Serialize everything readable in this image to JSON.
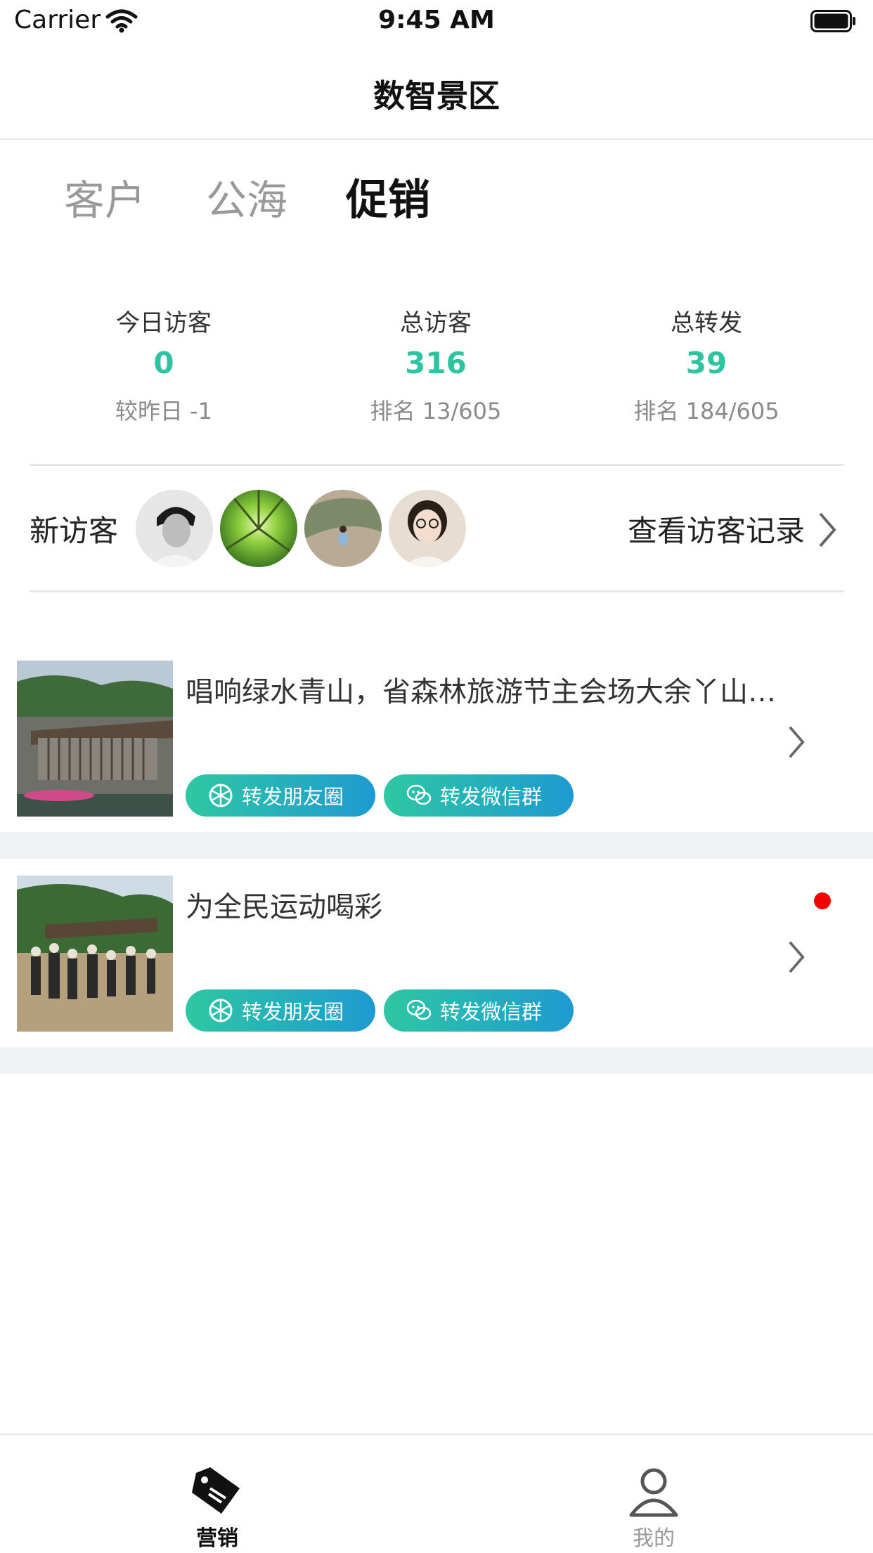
{
  "status_bar": {
    "carrier": "Carrier",
    "time": "9:45 AM"
  },
  "nav": {
    "title": "数智景区"
  },
  "tabs": [
    {
      "label": "客户",
      "active": false
    },
    {
      "label": "公海",
      "active": false
    },
    {
      "label": "促销",
      "active": true
    }
  ],
  "stats": [
    {
      "label": "今日访客",
      "value": "0",
      "sub": "较昨日 -1"
    },
    {
      "label": "总访客",
      "value": "316",
      "sub": "排名 13/605"
    },
    {
      "label": "总转发",
      "value": "39",
      "sub": "排名 184/605"
    }
  ],
  "visitors": {
    "label": "新访客",
    "view_records": "查看访客记录",
    "avatars": [
      "avatar-person-bw",
      "avatar-forest",
      "avatar-child-rock",
      "avatar-woman-glasses"
    ]
  },
  "articles": [
    {
      "title": "唱响绿水青山，省森林旅游节主会场大余丫山…",
      "share_moments": "转发朋友圈",
      "share_wechat_group": "转发微信群",
      "unread": false
    },
    {
      "title": "为全民运动喝彩",
      "share_moments": "转发朋友圈",
      "share_wechat_group": "转发微信群",
      "unread": true
    }
  ],
  "tabbar": [
    {
      "label": "营销",
      "icon": "tag-icon",
      "active": true
    },
    {
      "label": "我的",
      "icon": "person-icon",
      "active": false
    }
  ],
  "colors": {
    "accent": "#2ec4a1",
    "gradient_end": "#1e9ad1",
    "badge": "#f50000"
  }
}
